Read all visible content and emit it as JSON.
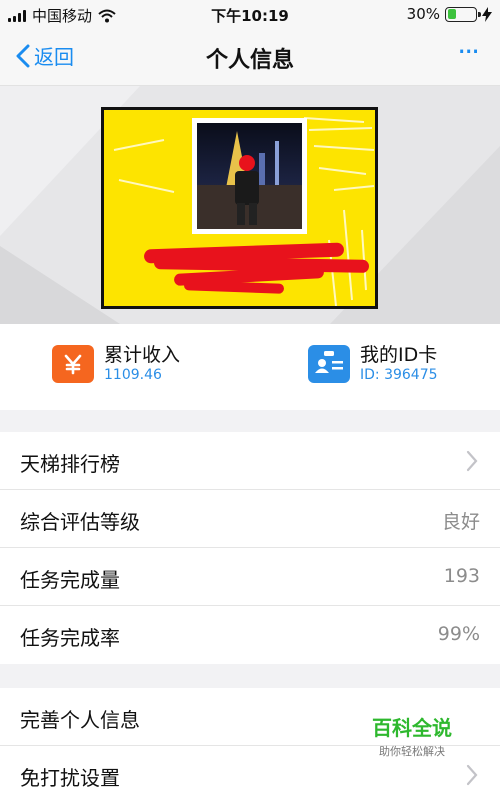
{
  "status_bar": {
    "carrier": "中国移动",
    "time": "下午10:19",
    "battery_percent": "30%",
    "battery_level": 0.3,
    "icons": [
      "signal-icon",
      "wifi-icon",
      "battery-icon",
      "charging-icon"
    ]
  },
  "nav": {
    "back_label": "返回",
    "title": "个人信息",
    "more_label": "···"
  },
  "shortcuts": [
    {
      "title": "累计收入",
      "value": "1109.46",
      "icon": "yen-icon",
      "color": "#f5661f"
    },
    {
      "title": "我的ID卡",
      "value": "ID: 396475",
      "icon": "id-card-icon",
      "color": "#2b8ee6"
    }
  ],
  "list_group_1": [
    {
      "label": "天梯排行榜",
      "value": "",
      "chevron": true
    },
    {
      "label": "综合评估等级",
      "value": "良好",
      "chevron": false
    },
    {
      "label": "任务完成量",
      "value": "193",
      "chevron": false
    },
    {
      "label": "任务完成率",
      "value": "99%",
      "chevron": false
    }
  ],
  "list_group_2": [
    {
      "label": "完善个人信息",
      "value": "",
      "chevron": false
    },
    {
      "label": "免打扰设置",
      "value": "",
      "chevron": true
    }
  ],
  "watermark": {
    "title": "百科全说",
    "subtitle": "助你轻松解决"
  },
  "colors": {
    "accent": "#1a8cf0",
    "card_yellow": "#fde400",
    "redaction": "#e8121c"
  }
}
